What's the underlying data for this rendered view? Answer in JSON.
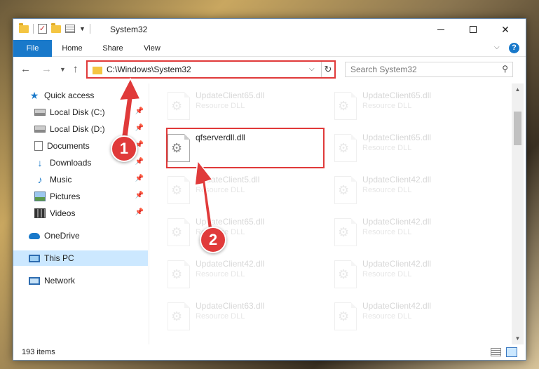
{
  "window": {
    "title": "System32",
    "buttons": {
      "minimize": "minimize",
      "maximize": "maximize",
      "close": "✕"
    }
  },
  "ribbon": {
    "tabs": [
      "File",
      "Home",
      "Share",
      "View"
    ]
  },
  "address": {
    "path": "C:\\Windows\\System32",
    "search_placeholder": "Search System32"
  },
  "sidebar": {
    "items": [
      {
        "label": "Quick access",
        "icon": "star-icon",
        "pinned": false
      },
      {
        "label": "Local Disk (C:)",
        "icon": "disk-icon",
        "pinned": true
      },
      {
        "label": "Local Disk (D:)",
        "icon": "disk-icon",
        "pinned": true
      },
      {
        "label": "Documents",
        "icon": "document-icon",
        "pinned": true
      },
      {
        "label": "Downloads",
        "icon": "download-icon",
        "pinned": true
      },
      {
        "label": "Music",
        "icon": "music-icon",
        "pinned": true
      },
      {
        "label": "Pictures",
        "icon": "pictures-icon",
        "pinned": true
      },
      {
        "label": "Videos",
        "icon": "videos-icon",
        "pinned": true
      },
      {
        "label": "OneDrive",
        "icon": "cloud-icon",
        "pinned": false
      },
      {
        "label": "This PC",
        "icon": "computer-icon",
        "pinned": false,
        "selected": true
      },
      {
        "label": "Network",
        "icon": "network-icon",
        "pinned": false
      }
    ]
  },
  "files": {
    "left_column": [
      {
        "name": "UpdateClient65.dll",
        "type": "Resource DLL"
      },
      {
        "name": "qfserverdll.dll",
        "type": ""
      },
      {
        "name": "UpdateClient5.dll",
        "type": "Resource DLL"
      },
      {
        "name": "UpdateClient65.dll",
        "type": "Resource DLL"
      },
      {
        "name": "UpdateClient42.dll",
        "type": "Resource DLL"
      },
      {
        "name": "UpdateClient63.dll",
        "type": "Resource DLL"
      }
    ],
    "right_column": [
      {
        "name": "UpdateClient65.dll",
        "type": "Resource DLL"
      },
      {
        "name": "UpdateClient65.dll",
        "type": "Resource DLL"
      },
      {
        "name": "UpdateClient42.dll",
        "type": "Resource DLL"
      },
      {
        "name": "UpdateClient42.dll",
        "type": "Resource DLL"
      },
      {
        "name": "UpdateClient42.dll",
        "type": "Resource DLL"
      },
      {
        "name": "UpdateClient42.dll",
        "type": "Resource DLL"
      }
    ]
  },
  "status": {
    "item_count": "193 items"
  },
  "annotations": {
    "step1": "1",
    "step2": "2",
    "accent_color": "#e03a3a"
  }
}
